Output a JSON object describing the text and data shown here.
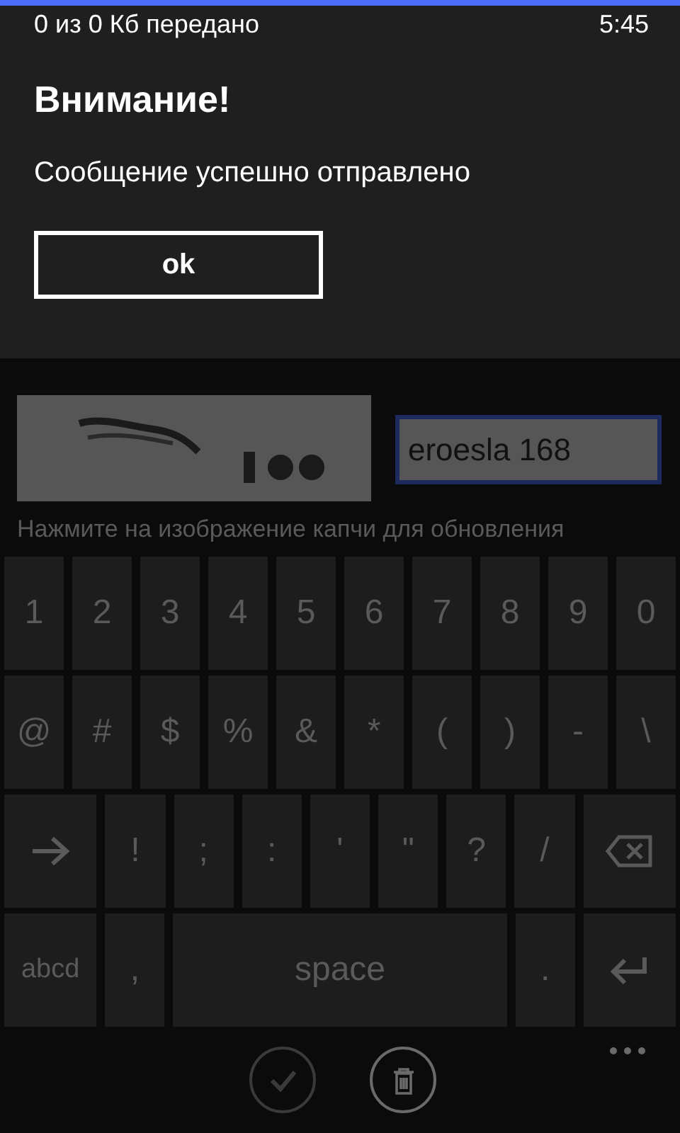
{
  "status_bar": {
    "transfer": "0 из 0 Кб передано",
    "time": "5:45"
  },
  "dialog": {
    "title": "Внимание!",
    "message": "Сообщение успешно отправлено",
    "button": "ok"
  },
  "captcha": {
    "input": {
      "value": "eroesla 168",
      "focused": true
    },
    "hint": "Нажмите на изображение капчи для обновления"
  },
  "keyboard": {
    "rows": [
      {
        "keys": [
          {
            "kind": "char",
            "label": "1"
          },
          {
            "kind": "char",
            "label": "2"
          },
          {
            "kind": "char",
            "label": "3"
          },
          {
            "kind": "char",
            "label": "4"
          },
          {
            "kind": "char",
            "label": "5"
          },
          {
            "kind": "char",
            "label": "6"
          },
          {
            "kind": "char",
            "label": "7"
          },
          {
            "kind": "char",
            "label": "8"
          },
          {
            "kind": "char",
            "label": "9"
          },
          {
            "kind": "char",
            "label": "0"
          }
        ]
      },
      {
        "keys": [
          {
            "kind": "char",
            "label": "@"
          },
          {
            "kind": "char",
            "label": "#"
          },
          {
            "kind": "char",
            "label": "$"
          },
          {
            "kind": "char",
            "label": "%"
          },
          {
            "kind": "char",
            "label": "&"
          },
          {
            "kind": "char",
            "label": "*"
          },
          {
            "kind": "char",
            "label": "("
          },
          {
            "kind": "char",
            "label": ")"
          },
          {
            "kind": "char",
            "label": "-"
          },
          {
            "kind": "char",
            "label": "\\"
          }
        ]
      },
      {
        "keys": [
          {
            "kind": "shift"
          },
          {
            "kind": "char",
            "label": "!"
          },
          {
            "kind": "char",
            "label": ";"
          },
          {
            "kind": "char",
            "label": ":"
          },
          {
            "kind": "char",
            "label": "'"
          },
          {
            "kind": "char",
            "label": "\""
          },
          {
            "kind": "char",
            "label": "?"
          },
          {
            "kind": "char",
            "label": "/"
          },
          {
            "kind": "backspace"
          }
        ]
      },
      {
        "keys": [
          {
            "kind": "mode",
            "label": "abcd"
          },
          {
            "kind": "char",
            "label": ","
          },
          {
            "kind": "space",
            "label": "space"
          },
          {
            "kind": "char",
            "label": "."
          },
          {
            "kind": "enter"
          }
        ]
      }
    ]
  },
  "app_bar": {
    "buttons": [
      {
        "kind": "check",
        "disabled": true
      },
      {
        "kind": "delete",
        "disabled": false
      }
    ]
  }
}
